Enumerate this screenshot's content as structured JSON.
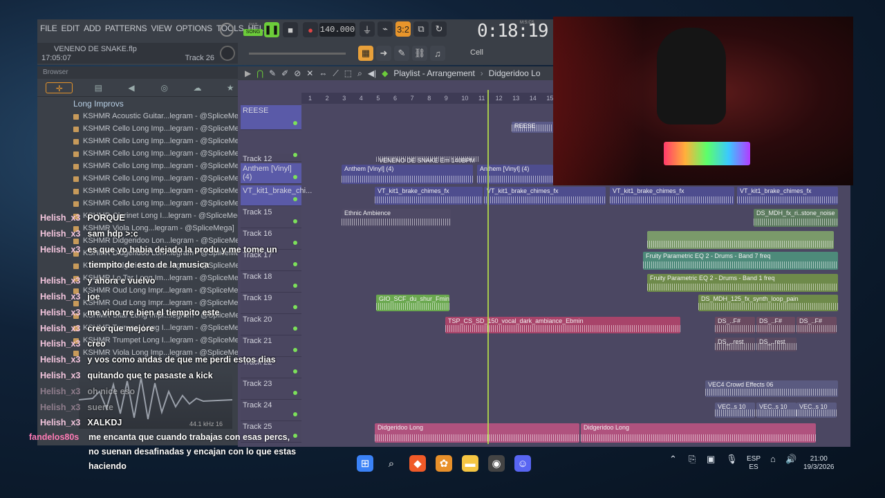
{
  "menu": {
    "items": [
      "FILE",
      "EDIT",
      "ADD",
      "PATTERNS",
      "VIEW",
      "OPTIONS",
      "TOOLS",
      "HELP"
    ]
  },
  "transport": {
    "mode_pat": "PAT",
    "mode_song": "SONG",
    "tempo": "140.000",
    "time": "0:18:19",
    "time_label": "M:S:CS",
    "snap": "Cell"
  },
  "project": {
    "filename": "VENENO DE SNAKE.flp",
    "time": "17:05:07",
    "track": "Track 26"
  },
  "browser": {
    "title": "Browser",
    "folder": "Long Improvs",
    "items": [
      "KSHMR Acoustic Guitar...legram - @SpliceMega]",
      "KSHMR Cello Long Imp...legram - @SpliceMega]",
      "KSHMR Cello Long Imp...legram - @SpliceMega]",
      "KSHMR Cello Long Imp...legram - @SpliceMega]",
      "KSHMR Cello Long Imp...legram - @SpliceMega]",
      "KSHMR Cello Long Imp...legram - @SpliceMega]",
      "KSHMR Cello Long Imp...legram - @SpliceMega]",
      "KSHMR Cello Long Imp...legram - @SpliceMega]",
      "KSHMR Clarinet Long I...legram - @SpliceMega]",
      "KSHMR Viola Long...legram - @SpliceMega]",
      "KSHMR Didgeridoo Lon...legram - @SpliceMega]",
      "KSHMR Didgeridoo Lon...legram - @SpliceMega]",
      "KSHMR Didgeridoo Lon...legram - @SpliceMega]",
      "KSHMR Lo Tar Long Im...legram - @SpliceMega]",
      "KSHMR Oud Long Impr...legram - @SpliceMega]",
      "KSHMR Oud Long Impr...legram - @SpliceMega]",
      "KSHMR Sitar Long Impr...legram - @SpliceMega]",
      "KSHMR Trumpet Long I...legram - @SpliceMega]",
      "KSHMR Trumpet Long I...legram - @SpliceMega]",
      "KSHMR Viola Long Imp...legram - @SpliceMega]"
    ],
    "sample_rate": "44.1 kHz 16"
  },
  "playlist": {
    "breadcrumb": "Playlist - Arrangement",
    "pattern": "Didgeridoo Lo",
    "ruler": [
      "1",
      "2",
      "3",
      "4",
      "5",
      "6",
      "7",
      "8",
      "9",
      "10",
      "11",
      "12",
      "13",
      "14",
      "15"
    ],
    "tracks": [
      "REESE",
      "Track 12",
      "Anthem [Vinyl] (4)",
      "VT_kit1_brake_chi...",
      "Track 15",
      "Track 16",
      "Track 17",
      "Track 18",
      "Track 19",
      "Track 20",
      "Track 21",
      "Track 22",
      "Track 23",
      "Track 24",
      "Track 25"
    ],
    "clips": {
      "reese": "REESE",
      "veneno": "VENENO DE SNAKE Em 140BPM",
      "anthem1": "Anthem [Vinyl] (4)",
      "anthem2": "Anthem [Vinyl] (4)",
      "vt1": "VT_kit1_brake_chimes_fx",
      "vt2": "VT_kit1_brake_chimes_fx",
      "vt3": "VT_kit1_brake_chimes_fx",
      "vt4": "VT_kit1_brake_chimes_fx",
      "ethnic": "Ethnic Ambience",
      "ds_stone": "DS_MDH_fx_ri..stone_noise",
      "eq_band7": "Fruity Parametric EQ 2 - Drums - Band 7 freq",
      "eq_band1": "Fruity Parametric EQ 2 - Drums - Band 1 freq",
      "gio": "GIO_SCF_du_shur_Fmin",
      "ds_synth": "DS_MDH_125_fx_synth_loop_pain",
      "tsp": "TSP_CS_SD_150_vocal_dark_ambiance_Ebmin",
      "ds_f1": "DS_..F#",
      "ds_f2": "DS_..F#",
      "ds_f3": "DS_..F#",
      "ds_rest1": "DS_..rest",
      "ds_rest2": "DS_..rest",
      "vec_crowd": "VEC4 Crowd Effects 06",
      "vec_s1": "VEC..s 10",
      "vec_s2": "VEC..s 10",
      "vec_s3": "VEC..s 10",
      "didg1": "Didgeridoo Long",
      "didg2": "Didgeridoo Long"
    }
  },
  "chat": [
    {
      "user": "Helish_x3",
      "msg": "PORQUE"
    },
    {
      "user": "Helish_x3",
      "msg": "sam hdp >:c"
    },
    {
      "user": "Helish_x3",
      "msg": "es que yo habia dejado la produ y me tome un"
    },
    {
      "user": "",
      "msg": "tiempito de esto de la musica"
    },
    {
      "user": "Helish_x3",
      "msg": "y ahora e vuelvo"
    },
    {
      "user": "Helish_x3",
      "msg": "joe"
    },
    {
      "user": "Helish_x3",
      "msg": "me vino rre bien el tiempito este"
    },
    {
      "user": "Helish_x3",
      "msg": "creo que mejore"
    },
    {
      "user": "Helish_x3",
      "msg": "creo"
    },
    {
      "user": "Helish_x3",
      "msg": "y vos como andas de que me perdi estos dias"
    },
    {
      "user": "Helish_x3",
      "msg": "quitando que te pasaste a kick"
    },
    {
      "user": "Helish_x3",
      "msg": "oh nice eso"
    },
    {
      "user": "Helish_x3",
      "msg": "suerte"
    },
    {
      "user": "Helish_x3",
      "msg": "XALKDJ"
    }
  ],
  "donation": {
    "user": "fandelos80s",
    "msg": "me encanta que cuando trabajas con esas percs, no suenan desafinadas y encajan con lo que estas haciendo"
  },
  "taskbar": {
    "lang": "ESP",
    "lang2": "ES",
    "time": "21:00",
    "date": "19/3/2026"
  },
  "colors": {
    "accent": "#e8952b",
    "playhead": "#b6e04a",
    "chat_user": "#f3c5dd",
    "donation_user": "#ff7bb5"
  }
}
